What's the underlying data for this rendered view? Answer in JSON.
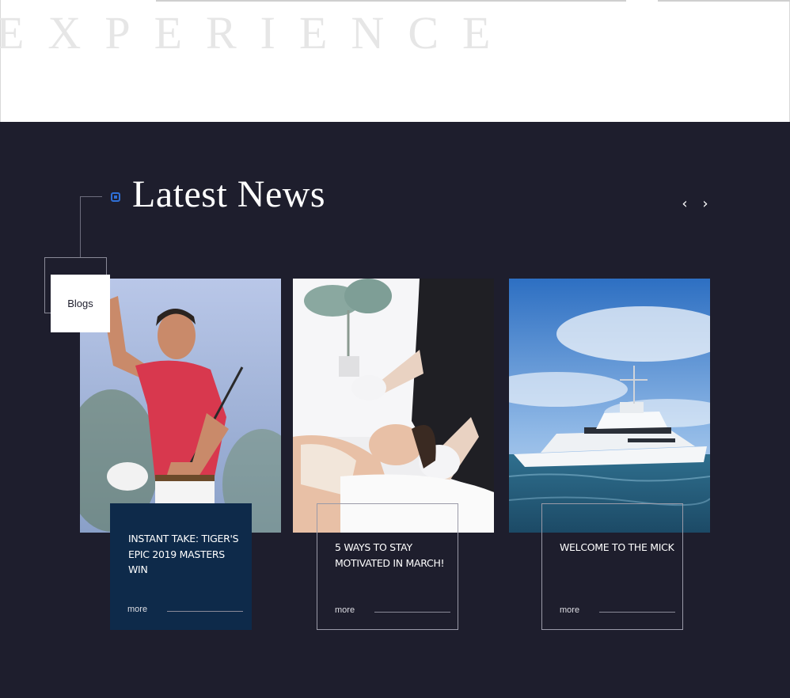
{
  "header": {
    "watermark": "EXPERIENCE"
  },
  "section": {
    "title": "Latest News",
    "tag_label": "Blogs",
    "nav": {
      "prev": "‹",
      "next": "›"
    }
  },
  "cards": [
    {
      "title": "INSTANT TAKE: TIGER'S EPIC 2019 MASTERS WIN",
      "more": "more"
    },
    {
      "title": "5 WAYS TO STAY MOTIVATED IN MARCH!",
      "more": "more"
    },
    {
      "title": "WELCOME TO THE MICK",
      "more": "more"
    }
  ],
  "colors": {
    "background": "#1e1e2d",
    "accent": "#2f6fd6",
    "featured_card": "#0e2a4a",
    "text": "#ffffff"
  }
}
